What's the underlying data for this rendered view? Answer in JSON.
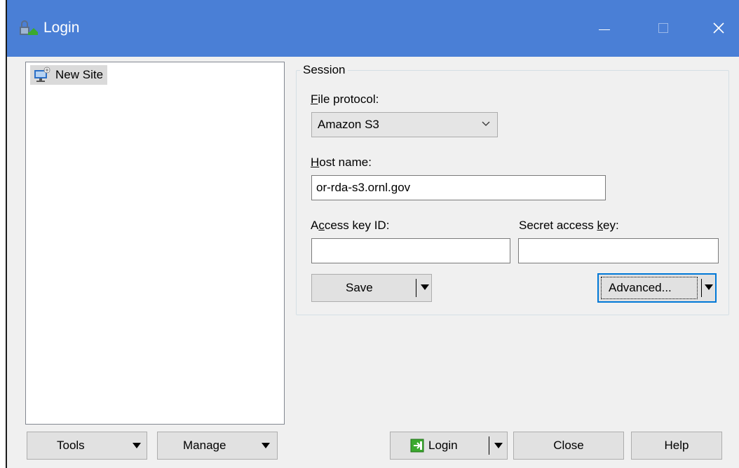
{
  "window": {
    "title": "Login"
  },
  "titlebar_buttons": {
    "minimize": "minimize-icon",
    "maximize": "maximize-icon",
    "close": "close-icon"
  },
  "sites": {
    "items": [
      {
        "label": "New Site",
        "icon": "site-icon",
        "selected": true
      }
    ]
  },
  "session": {
    "legend": "Session",
    "file_protocol": {
      "label_first": "F",
      "label_rest": "ile protocol:",
      "value": "Amazon S3"
    },
    "host_name": {
      "label_first": "H",
      "label_rest": "ost name:",
      "value": "or-rda-s3.ornl.gov"
    },
    "access_key": {
      "label_first": "A",
      "label_underline": "c",
      "label_rest": "cess key ID:",
      "value": ""
    },
    "secret_key": {
      "label_start": "Secret access ",
      "label_underline": "k",
      "label_rest": "ey:",
      "value": ""
    },
    "save_button": "Save",
    "advanced_button": "Advanced..."
  },
  "bottom_bar": {
    "tools": "Tools",
    "manage": "Manage",
    "login": "Login",
    "close": "Close",
    "help": "Help"
  },
  "colors": {
    "titlebar": "#4a7fd6",
    "dialog_bg": "#f0f0f0",
    "focus_border": "#0078d7"
  }
}
